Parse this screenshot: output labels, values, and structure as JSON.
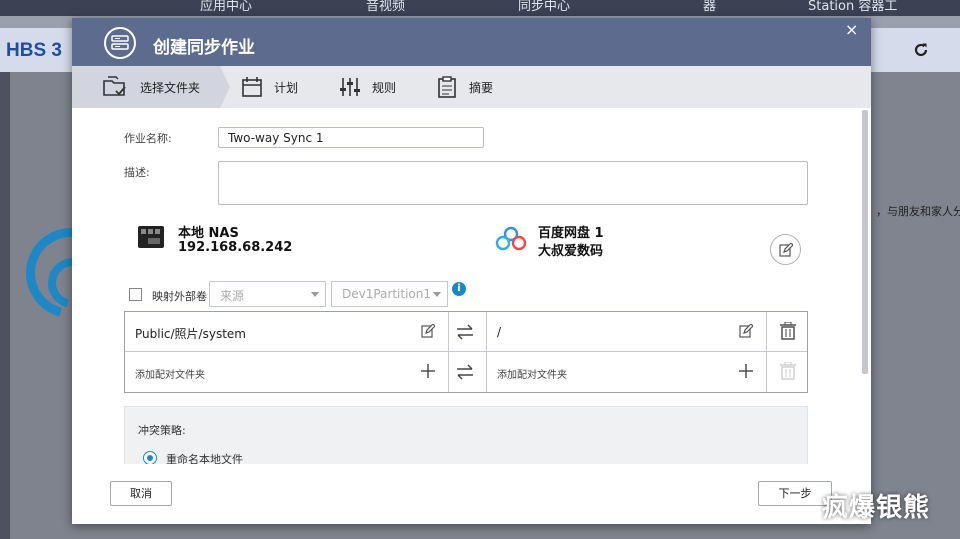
{
  "background": {
    "topbar_items": [
      "应用中心",
      "音视频",
      "同步中心",
      "器",
      "Station 容器工"
    ],
    "app_title": "HBS 3",
    "refresh_icon": "refresh-icon",
    "side_text": "，与朋友和家人分"
  },
  "dialog": {
    "title": "创建同步作业",
    "close_label": "×",
    "steps": [
      {
        "label": "选择文件夹",
        "icon": "folder-check-icon",
        "active": true
      },
      {
        "label": "计划",
        "icon": "calendar-icon",
        "active": false
      },
      {
        "label": "规则",
        "icon": "sliders-icon",
        "active": false
      },
      {
        "label": "摘要",
        "icon": "clipboard-icon",
        "active": false
      }
    ],
    "form": {
      "job_name_label": "作业名称:",
      "job_name_value": "Two-way Sync 1",
      "description_label": "描述:",
      "description_value": ""
    },
    "source": {
      "name": "本地 NAS",
      "address": "192.168.68.242"
    },
    "destination": {
      "name": "百度网盘 1",
      "account": "大叔爱数码"
    },
    "mount": {
      "checkbox_label": "映射外部卷",
      "checked": false,
      "source_select": "来源",
      "partition_select": "Dev1Partition1",
      "info_label": "i"
    },
    "pairs": [
      {
        "local": "Public/照片/system",
        "remote": "/",
        "direction": "⇆"
      },
      {
        "local": "添加配对文件夹",
        "remote": "添加配对文件夹",
        "direction": "⇆"
      }
    ],
    "conflict": {
      "title": "冲突策略:",
      "selected_option": "重命名本地文件"
    },
    "buttons": {
      "cancel": "取消",
      "next": "下一步"
    }
  },
  "watermark": "疯爆银熊",
  "colors": {
    "header": "#5d6b8e",
    "accent": "#1e88c6",
    "steps_bg": "#e6e8ec"
  }
}
